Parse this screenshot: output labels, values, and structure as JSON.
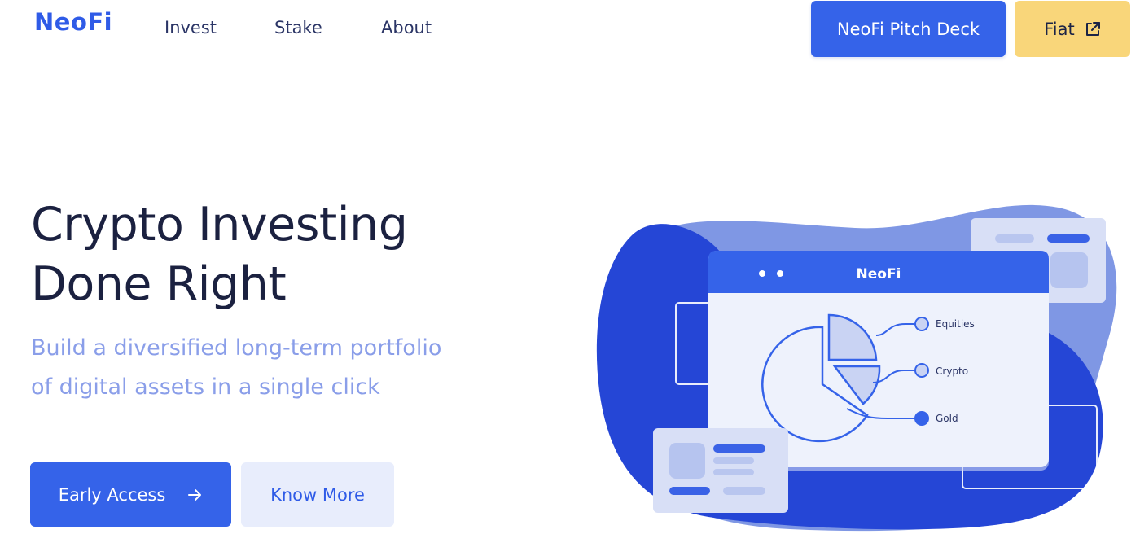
{
  "header": {
    "logo": "NeoFi",
    "nav": [
      {
        "label": "Invest"
      },
      {
        "label": "Stake"
      },
      {
        "label": "About"
      }
    ],
    "pitch_deck_label": "NeoFi Pitch Deck",
    "fiat_label": "Fiat",
    "fiat_icon": "external-link-icon"
  },
  "hero": {
    "title_line1": "Crypto Investing",
    "title_line2": "Done Right",
    "subtitle_line1": "Build a diversified long-term portfolio",
    "subtitle_line2": "of digital assets in a single click",
    "early_access_label": "Early Access",
    "early_access_icon": "arrow-right-icon",
    "know_more_label": "Know More"
  },
  "illustration": {
    "window_title": "NeoFi",
    "legend": [
      {
        "label": "Equities"
      },
      {
        "label": "Crypto"
      },
      {
        "label": "Gold"
      }
    ]
  },
  "colors": {
    "primary": "#3563e9",
    "accent_yellow": "#f9d67a",
    "heading": "#1b2140",
    "subtitle": "#8a9ee9",
    "secondary_button_bg": "#e8edfc",
    "blob_dark": "#2546d6",
    "blob_light": "#7f97e4"
  }
}
